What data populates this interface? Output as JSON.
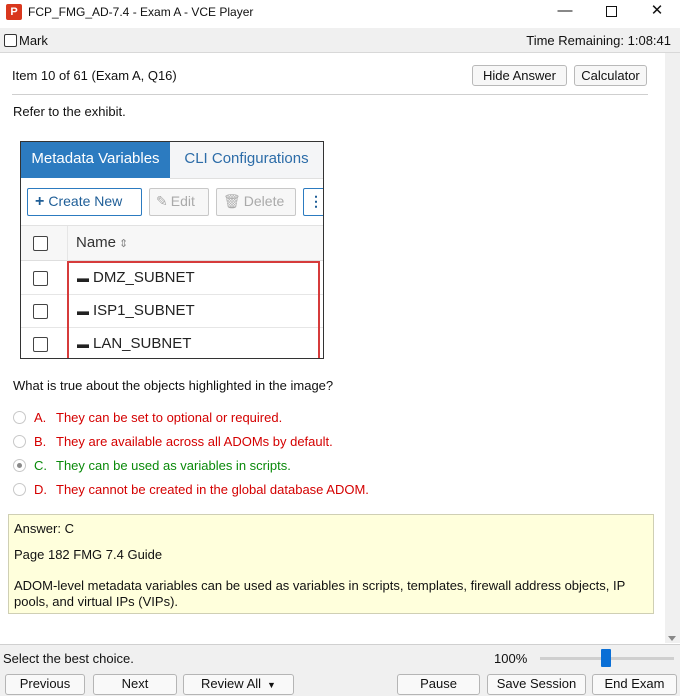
{
  "window": {
    "title": "FCP_FMG_AD-7.4 - Exam A - VCE Player",
    "app_icon": "P",
    "minimize_glyph": "—",
    "close_glyph": "✕"
  },
  "toolbar": {
    "mark_label": "Mark",
    "time_remaining": "Time Remaining: 1:08:41"
  },
  "header": {
    "item_label": "Item 10 of 61  (Exam A, Q16)",
    "hide_answer_label": "Hide Answer",
    "calculator_label": "Calculator"
  },
  "question": {
    "refer_text": "Refer to the exhibit.",
    "text": "What is true about the objects highlighted in the image?",
    "options": [
      {
        "letter": "A.",
        "text": "They can be set to optional or required.",
        "selected": false,
        "status": "wrong"
      },
      {
        "letter": "B.",
        "text": "They are available across all ADOMs by default.",
        "selected": false,
        "status": "wrong"
      },
      {
        "letter": "C.",
        "text": "They can be used as variables in scripts.",
        "selected": true,
        "status": "correct"
      },
      {
        "letter": "D.",
        "text": "They cannot be created in the global database ADOM.",
        "selected": false,
        "status": "wrong"
      }
    ]
  },
  "exhibit": {
    "tabs": [
      "Metadata Variables",
      "CLI Configurations"
    ],
    "buttons": {
      "create_new": "Create New",
      "edit": "Edit",
      "delete": "Delete"
    },
    "column_header": "Name",
    "rows": [
      "DMZ_SUBNET",
      "ISP1_SUBNET",
      "LAN_SUBNET"
    ],
    "highlight_color": "#d63b3b",
    "active_tab_color": "#2c7bc0"
  },
  "answer": {
    "answer_line": "Answer: C",
    "reference": "Page 182 FMG 7.4 Guide",
    "explanation_line1": "ADOM-level metadata variables can be used as variables in scripts, templates, firewall address objects, IP",
    "explanation_line2": "pools, and virtual IPs (VIPs)."
  },
  "status": {
    "text": "Select the best choice.",
    "zoom": "100%"
  },
  "nav": {
    "previous": "Previous",
    "next": "Next",
    "review_all": "Review All",
    "pause": "Pause",
    "save_session": "Save Session",
    "end_exam": "End Exam"
  },
  "colors": {
    "wrong": "#d40000",
    "correct": "#0a8a0a",
    "answer_bg": "#ffffdc"
  }
}
